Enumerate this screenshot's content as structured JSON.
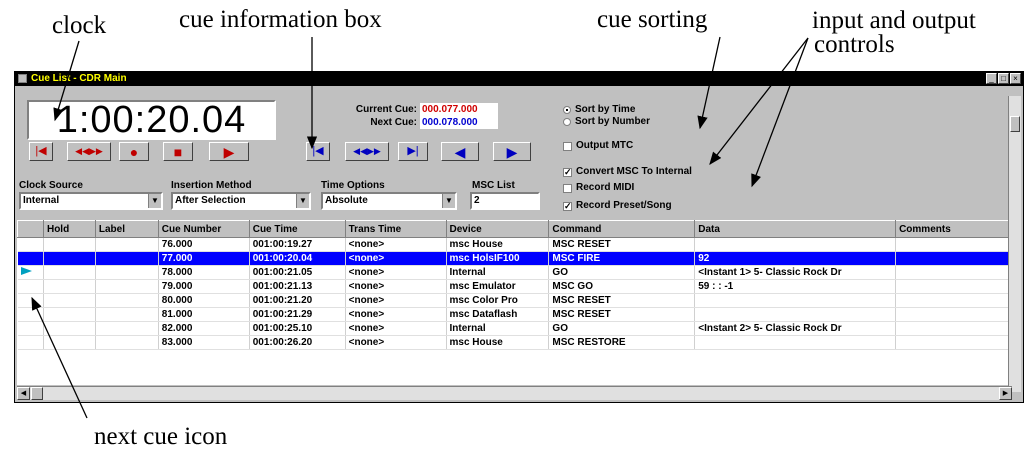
{
  "annotations": {
    "clock": "clock",
    "cue_info_box": "cue information box",
    "cue_sorting": "cue sorting",
    "io_controls_1": "input and output",
    "io_controls_2": "controls",
    "next_cue_icon": "next cue icon"
  },
  "window": {
    "title": "Cue List - CDR Main",
    "controls": [
      "minimize-icon",
      "maximize-icon",
      "close-icon"
    ]
  },
  "clock": {
    "time": "1:00:20.04"
  },
  "transport": {
    "buttons": [
      {
        "icon": "skip-to-start-icon",
        "glyph": "|◀"
      },
      {
        "icon": "rewind-fast-forward-icon",
        "glyph": "◀◀▶▶"
      },
      {
        "icon": "record-icon",
        "glyph": "●"
      },
      {
        "icon": "stop-icon",
        "glyph": "■"
      },
      {
        "icon": "play-icon",
        "glyph": "▶"
      }
    ]
  },
  "cue_info": {
    "current_label": "Current Cue:",
    "current_value": "000.077.000",
    "current_color": "#d00000",
    "next_label": "Next Cue:",
    "next_value": "000.078.000",
    "next_color": "#0000d0",
    "buttons": [
      {
        "icon": "first-cue-icon",
        "glyph": "|◀"
      },
      {
        "icon": "step-cues-icon",
        "glyph": "◀◀▶▶"
      },
      {
        "icon": "last-cue-icon",
        "glyph": "▶|"
      },
      {
        "icon": "previous-cue-icon",
        "glyph": "◀"
      },
      {
        "icon": "go-cue-icon",
        "glyph": "▶"
      }
    ]
  },
  "settings": {
    "clock_source_label": "Clock Source",
    "clock_source_value": "Internal",
    "insertion_label": "Insertion Method",
    "insertion_value": "After Selection",
    "time_options_label": "Time Options",
    "time_options_value": "Absolute",
    "msc_list_label": "MSC List",
    "msc_list_value": "2"
  },
  "options": {
    "sort_time": "Sort by Time",
    "sort_number": "Sort by Number",
    "output_mtc": "Output MTC",
    "convert_msc": "Convert MSC To Internal",
    "record_midi": "Record MIDI",
    "record_preset": "Record Preset/Song",
    "sort_time_selected": true,
    "output_mtc_checked": false,
    "convert_msc_checked": true,
    "record_midi_checked": false,
    "record_preset_checked": true
  },
  "table": {
    "columns": [
      "",
      "Hold",
      "Label",
      "Cue Number",
      "Cue Time",
      "Trans Time",
      "Device",
      "Command",
      "Data",
      "Comments"
    ],
    "rows": [
      [
        "",
        "",
        "",
        "76.000",
        "001:00:19.27",
        "<none>",
        "msc House",
        "MSC RESET",
        "",
        ""
      ],
      [
        "",
        "",
        "",
        "77.000",
        "001:00:20.04",
        "<none>",
        "msc HolsIF100",
        "MSC FIRE",
        "92",
        ""
      ],
      [
        "next",
        "",
        "",
        "78.000",
        "001:00:21.05",
        "<none>",
        "Internal",
        "GO",
        "<Instant 1> 5- Classic Rock Dr",
        ""
      ],
      [
        "",
        "",
        "",
        "79.000",
        "001:00:21.13",
        "<none>",
        "msc Emulator",
        "MSC GO",
        "59 : : -1",
        ""
      ],
      [
        "",
        "",
        "",
        "80.000",
        "001:00:21.20",
        "<none>",
        "msc Color Pro",
        "MSC RESET",
        "",
        ""
      ],
      [
        "",
        "",
        "",
        "81.000",
        "001:00:21.29",
        "<none>",
        "msc Dataflash",
        "MSC RESET",
        "",
        ""
      ],
      [
        "",
        "",
        "",
        "82.000",
        "001:00:25.10",
        "<none>",
        "Internal",
        "GO",
        "<Instant 2> 5- Classic Rock Dr",
        ""
      ],
      [
        "",
        "",
        "",
        "83.000",
        "001:00:26.20",
        "<none>",
        "msc House",
        "MSC RESTORE",
        "",
        ""
      ]
    ],
    "selected_row": 1
  },
  "colors": {
    "selection": "#0000ff",
    "next_cue_icon": "#00a0c0",
    "title_text": "#ffff00"
  }
}
